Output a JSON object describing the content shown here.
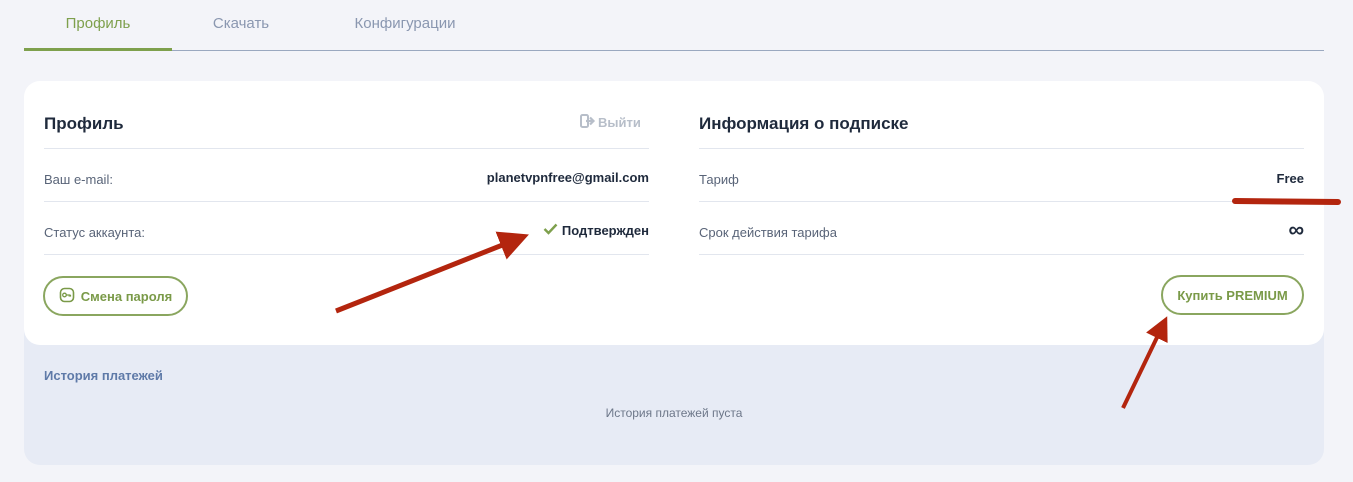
{
  "tabs": [
    {
      "label": "Профиль",
      "active": true
    },
    {
      "label": "Скачать",
      "active": false
    },
    {
      "label": "Конфигурации",
      "active": false
    }
  ],
  "profile": {
    "title": "Профиль",
    "logout_label": "Выйти",
    "email_label": "Ваш e-mail:",
    "email_value": "planetvpnfree@gmail.com",
    "status_label": "Статус аккаунта:",
    "status_value": "Подтвержден",
    "change_password_label": "Смена пароля"
  },
  "subscription": {
    "title": "Информация о подписке",
    "plan_label": "Тариф",
    "plan_value": "Free",
    "expiry_label": "Срок действия тарифа",
    "expiry_value": "∞",
    "buy_premium_label": "Купить PREMIUM"
  },
  "history": {
    "title": "История платежей",
    "empty_text": "История платежей пуста"
  },
  "colors": {
    "accent_green": "#7ea04d",
    "annotation_red": "#b3250e"
  },
  "icons": {
    "logout": "logout-icon",
    "check": "check-icon",
    "key": "key-icon",
    "infinity": "infinity-icon"
  }
}
